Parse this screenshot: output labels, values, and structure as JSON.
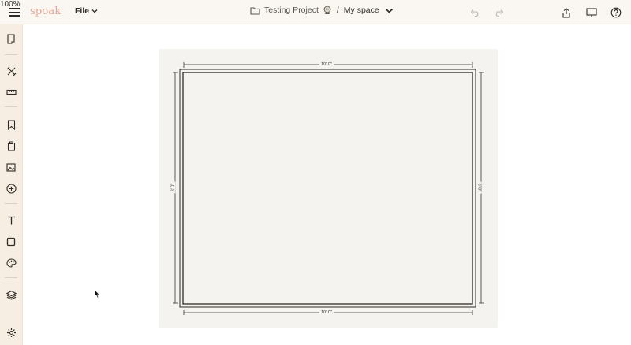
{
  "topbar": {
    "logo": "spoak",
    "file_label": "File",
    "project_name": "Testing Project",
    "separator": "/",
    "space_name": "My space",
    "zoom": "100%"
  },
  "icons": {
    "menu": "hamburger-icon",
    "folder": "folder-icon",
    "avatar": "avatar-icon",
    "undo": "undo-icon",
    "redo": "redo-icon",
    "share": "share-icon",
    "present": "monitor-icon",
    "help": "help-icon"
  },
  "sidebar": {
    "items": [
      "floorplan-icon",
      "tools-icon",
      "ruler-icon",
      "bookmark-icon",
      "clipboard-icon",
      "image-icon",
      "add-icon",
      "text-icon",
      "shape-icon",
      "palette-icon",
      "layers-icon",
      "settings-icon"
    ]
  },
  "floorplan": {
    "top_width": "10' 0\"",
    "bottom_width": "10' 0\"",
    "left_height": "8' 0\"",
    "right_height": "8' 0\""
  },
  "colors": {
    "topbar_bg": "#faf7f2",
    "sidebar_bg": "#f6eee2",
    "canvas_bg": "#f4f3ef",
    "logo": "#e7a58f"
  }
}
